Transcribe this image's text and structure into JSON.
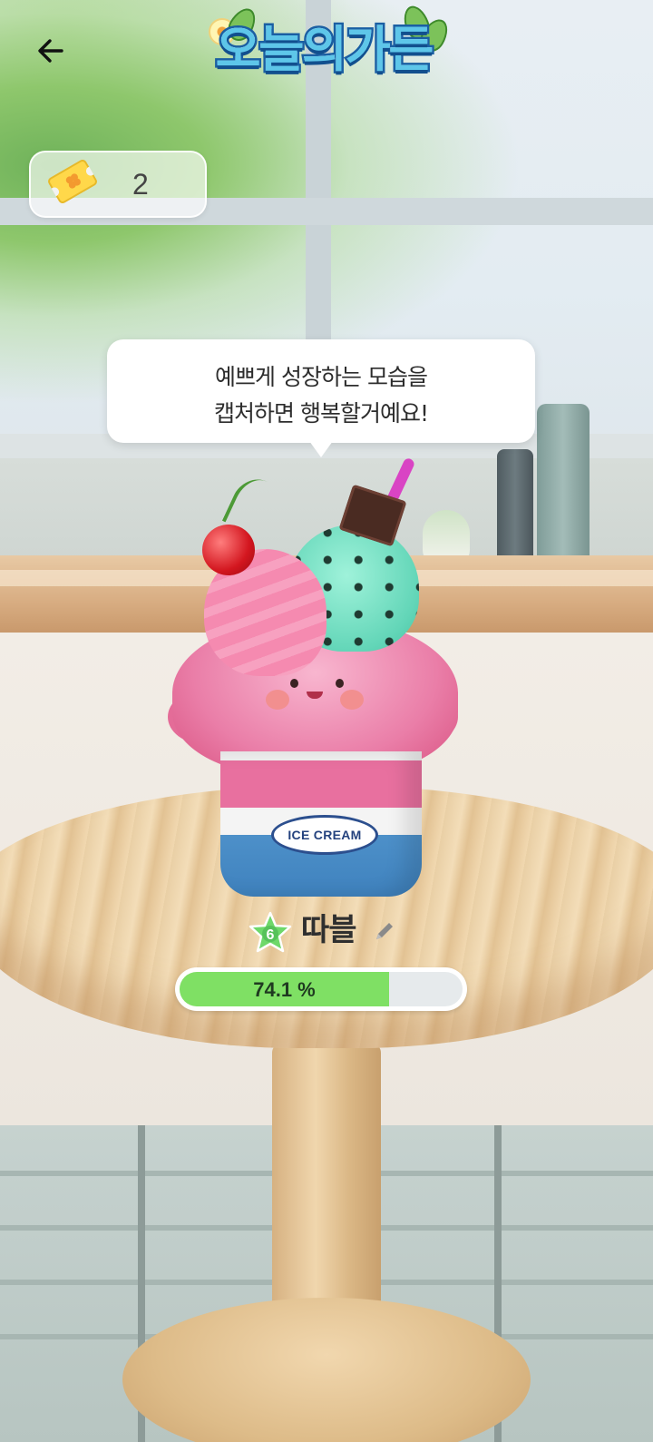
{
  "header": {
    "back_icon": "arrow-left-icon",
    "logo_text": "오늘의가든"
  },
  "tickets": {
    "icon": "ticket-clover-icon",
    "count": "2"
  },
  "speech_bubble": {
    "line1": "예쁘게 성장하는 모습을",
    "line2": "캡처하면 행복할거예요!"
  },
  "character": {
    "level": "6",
    "name": "따블",
    "edit_icon": "pencil-icon",
    "cup_label": "ICE CREAM"
  },
  "growth": {
    "progress_percent": 74.1,
    "label": "74.1 %"
  },
  "colors": {
    "progress_fill": "#7fe064",
    "level_star": "#6ed86a",
    "logo_fill": "#5ec6e9",
    "logo_outline": "#1a5fa3"
  }
}
